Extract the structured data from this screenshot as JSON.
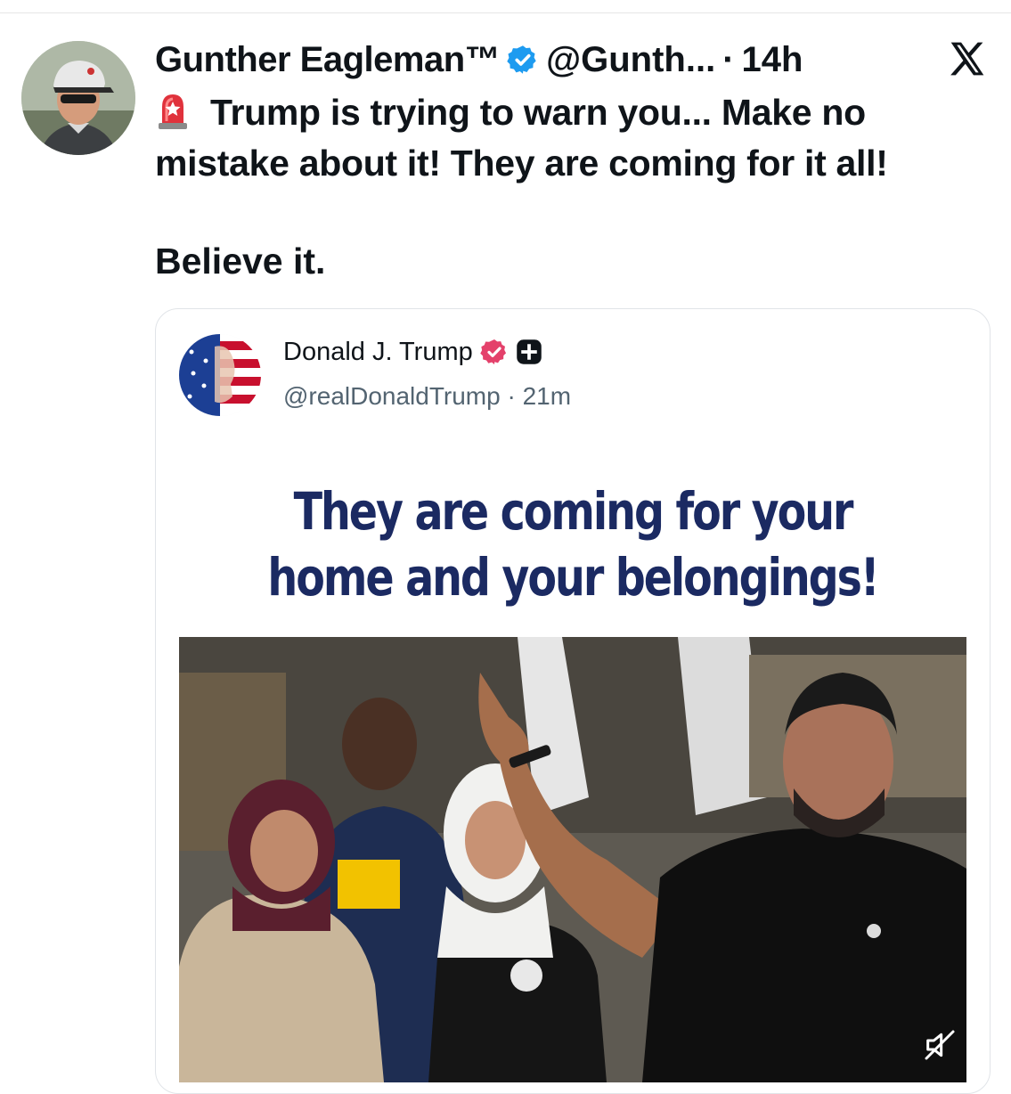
{
  "tweet": {
    "display_name": "Gunther Eagleman™",
    "handle": "@Gunth...",
    "separator": "·",
    "time": "14h",
    "text_line1": "Trump is trying to warn you... Make no",
    "text_line2": "mistake about it!  They are coming for it all!",
    "text_line3": "Believe it.",
    "emoji": "rotating-light-icon"
  },
  "quote": {
    "display_name": "Donald J. Trump",
    "handle": "@realDonaldTrump",
    "separator": "·",
    "time": "21m",
    "headline_line1": "They are coming for your",
    "headline_line2": "home and your belongings!"
  },
  "colors": {
    "verified_blue": "#1d9bf0",
    "truth_badge_pink": "#e4416b",
    "headline_navy": "#1b2a62",
    "text": "#0f1419",
    "muted": "#536471"
  },
  "icons": [
    "verified-badge-icon",
    "x-logo-icon",
    "truth-social-plus-icon",
    "sound-muted-icon"
  ]
}
